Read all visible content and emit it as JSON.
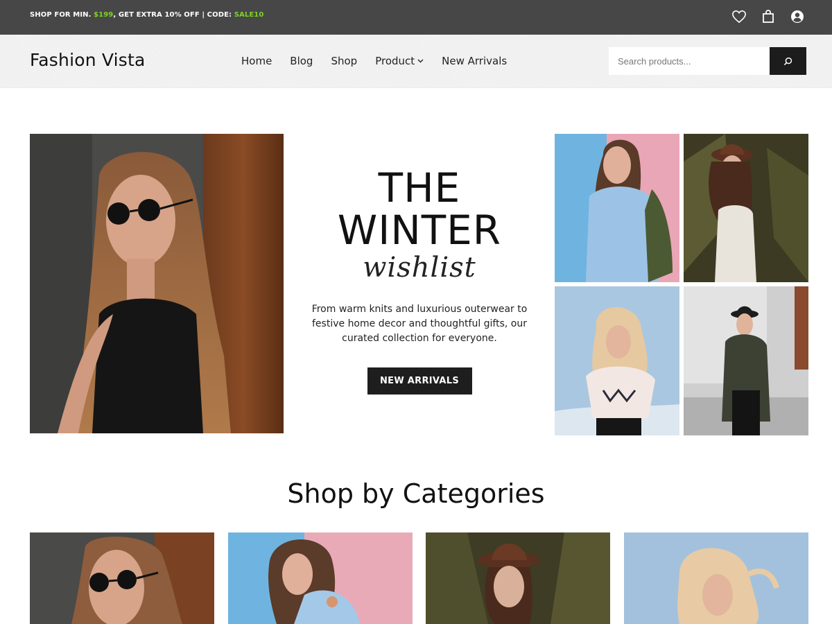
{
  "topbar": {
    "promo_part1": "SHOP FOR MIN. ",
    "promo_price": "$199",
    "promo_part2": ", GET EXTRA 10% OFF | CODE: ",
    "promo_code": "SALE10",
    "icons": [
      "heart-icon",
      "shopping-bag-icon",
      "user-icon"
    ]
  },
  "header": {
    "logo": "Fashion Vista",
    "nav": [
      "Home",
      "Blog",
      "Shop",
      "Product",
      "New Arrivals"
    ],
    "search_placeholder": "Search products..."
  },
  "hero": {
    "title_line1": "THE",
    "title_line2": "WINTER",
    "title_script": "wishlist",
    "description": "From warm knits and luxurious outerwear to festive home decor and thoughtful gifts, our curated collection for everyone.",
    "button_label": "NEW ARRIVALS"
  },
  "categories": {
    "title": "Shop by Categories"
  },
  "colors": {
    "topbar_bg": "#474747",
    "promo_highlight": "#7ed321",
    "button_bg": "#1e1e1e"
  }
}
